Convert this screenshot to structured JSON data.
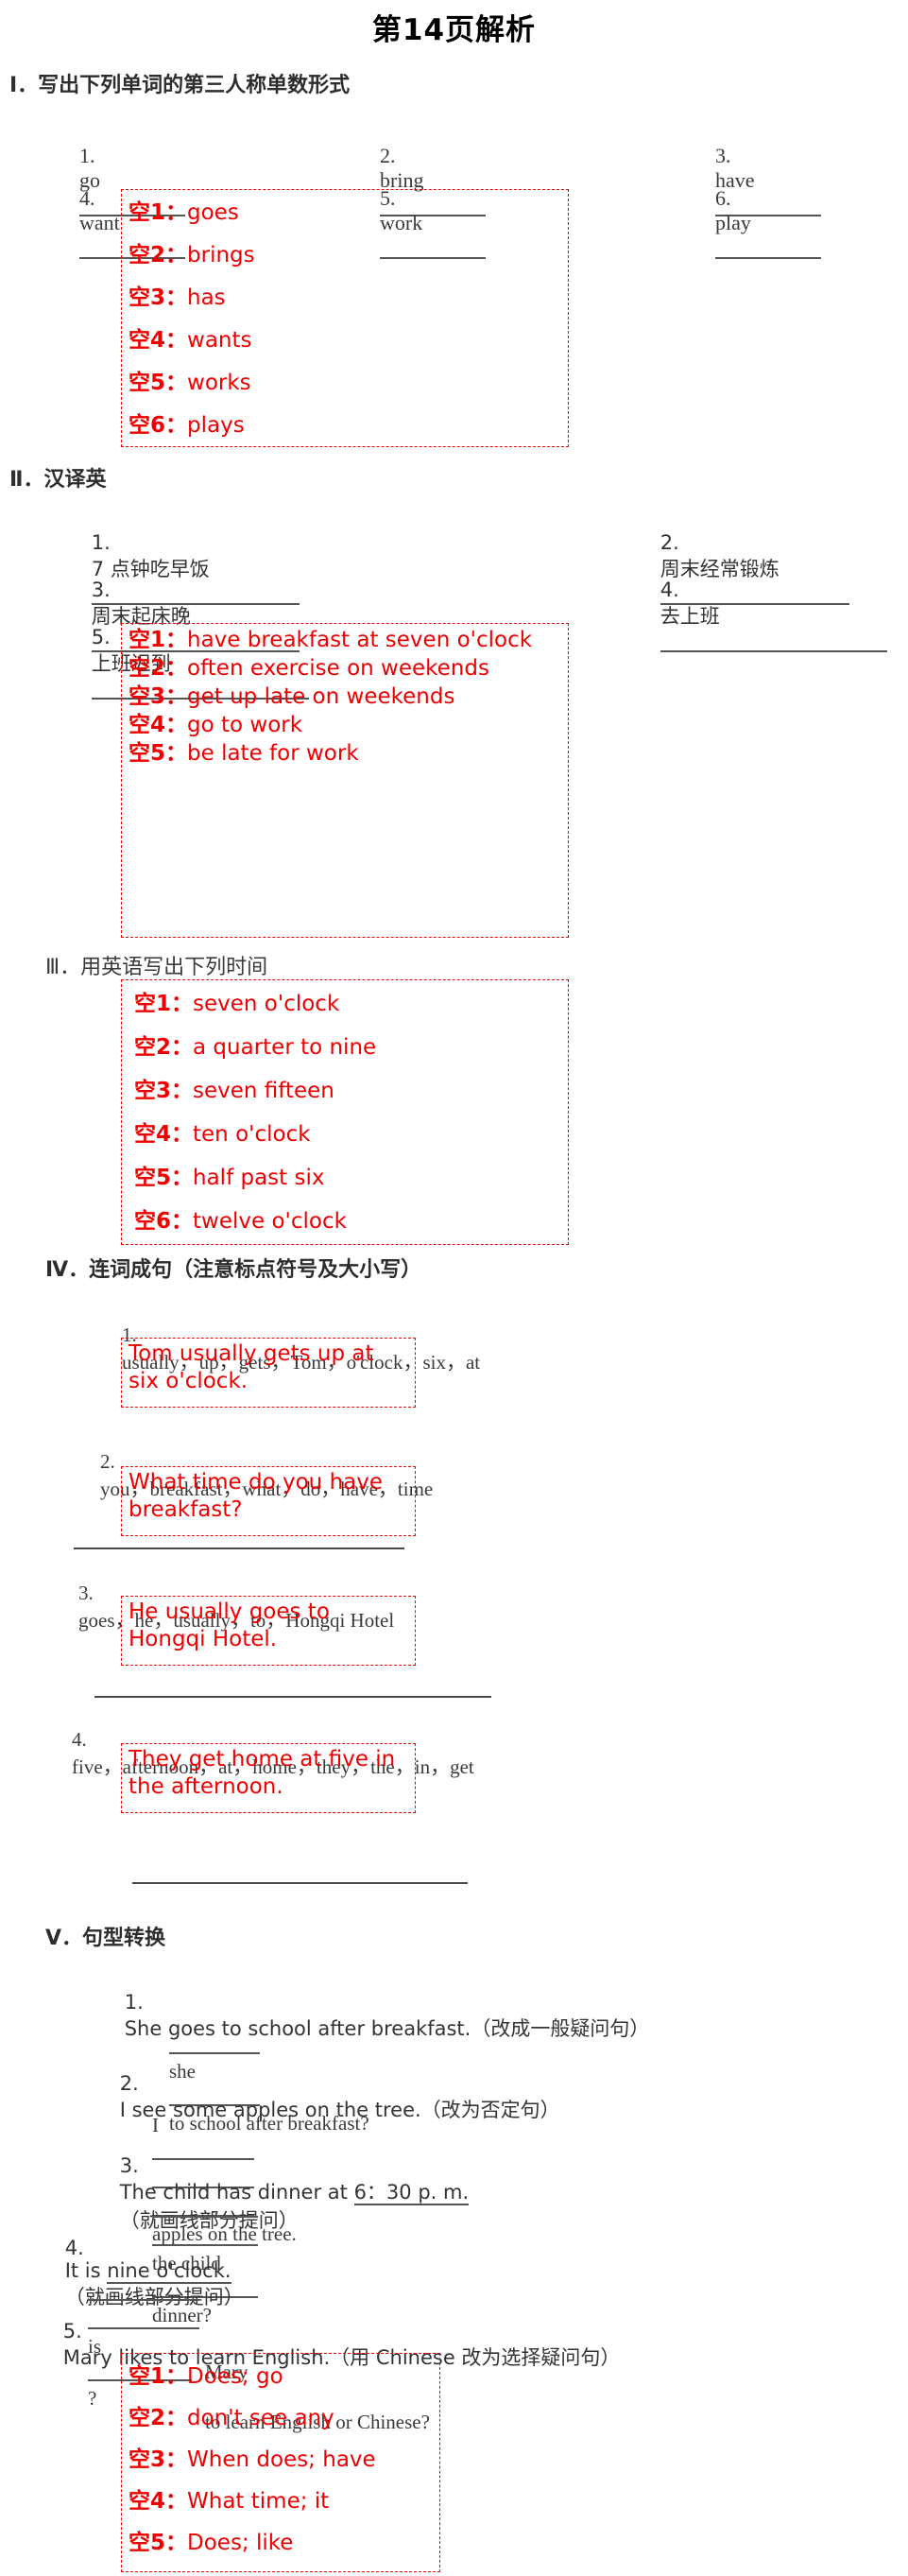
{
  "page": {
    "title": "第14页解析",
    "answer_label_prefix": "空",
    "answer_separator": "："
  },
  "sections": [
    {
      "id": "I",
      "numeral": "Ⅰ",
      "heading": "Ⅰ．写出下列单词的第三人称单数形式",
      "items": [
        {
          "num": "1.",
          "text": "go"
        },
        {
          "num": "2.",
          "text": "bring"
        },
        {
          "num": "3.",
          "text": "have"
        },
        {
          "num": "4.",
          "text": "want"
        },
        {
          "num": "5.",
          "text": "work"
        },
        {
          "num": "6.",
          "text": "play"
        }
      ],
      "answers": [
        {
          "label": "空1：",
          "value": "goes"
        },
        {
          "label": "空2：",
          "value": "brings"
        },
        {
          "label": "空3：",
          "value": "has"
        },
        {
          "label": "空4：",
          "value": "wants"
        },
        {
          "label": "空5：",
          "value": "works"
        },
        {
          "label": "空6：",
          "value": "plays"
        }
      ]
    },
    {
      "id": "II",
      "numeral": "Ⅱ",
      "heading": "Ⅱ．汉译英",
      "items": [
        {
          "num": "1.",
          "text": "7 点钟吃早饭"
        },
        {
          "num": "2.",
          "text": "周末经常锻炼"
        },
        {
          "num": "3.",
          "text": "周末起床晚"
        },
        {
          "num": "4.",
          "text": "去上班"
        },
        {
          "num": "5.",
          "text": "上班迟到"
        }
      ],
      "answers": [
        {
          "label": "空1：",
          "value": "have breakfast at seven o'clock"
        },
        {
          "label": "空2：",
          "value": "often exercise on weekends"
        },
        {
          "label": "空3：",
          "value": "get up late on weekends"
        },
        {
          "label": "空4：",
          "value": "go to work"
        },
        {
          "label": "空5：",
          "value": "be late for work"
        }
      ]
    },
    {
      "id": "III",
      "numeral": "Ⅲ",
      "heading": "Ⅲ．用英语写出下列时间",
      "items": [],
      "answers": [
        {
          "label": "空1：",
          "value": "seven o'clock"
        },
        {
          "label": "空2：",
          "value": "a quarter to nine"
        },
        {
          "label": "空3：",
          "value": "seven fifteen"
        },
        {
          "label": "空4：",
          "value": "ten o'clock"
        },
        {
          "label": "空5：",
          "value": "half past six"
        },
        {
          "label": "空6：",
          "value": "twelve o'clock"
        }
      ]
    },
    {
      "id": "IV",
      "numeral": "Ⅳ",
      "heading": "Ⅳ．连词成句（注意标点符号及大小写）",
      "items": [
        {
          "num": "1.",
          "text": "usually，up，gets，Tom，o'clock，six，at",
          "answer": "Tom usually gets up at six o'clock."
        },
        {
          "num": "2.",
          "text": "you，breakfast，what，do，have，time",
          "answer": "What time do you have breakfast?"
        },
        {
          "num": "3.",
          "text": "goes，he，usually，to，Hongqi Hotel",
          "answer": "He usually goes to Hongqi Hotel."
        },
        {
          "num": "4.",
          "text": "five，afternoon，at，home，they，the，in，get",
          "answer": "They get home at five in the afternoon."
        }
      ]
    },
    {
      "id": "V",
      "numeral": "Ⅴ",
      "heading": "Ⅴ．句型转换",
      "items": [
        {
          "num": "1.",
          "prompt": "She goes to school after breakfast.（改成一般疑问句）",
          "answer_line_pre": "",
          "answer_line_mid": "she",
          "answer_line_post": "to school after breakfast?"
        },
        {
          "num": "2.",
          "prompt": "I see some apples on the tree.（改为否定句）",
          "answer_line_pre": "I",
          "answer_line_post": "apples on the tree."
        },
        {
          "num": "3.",
          "prompt_pre": "The child has dinner at ",
          "prompt_underline": "6：30 p. m.",
          "prompt_post": "（就画线部分提问）",
          "answer_line_mid": "the child",
          "answer_line_post": "dinner?"
        },
        {
          "num": "4.",
          "prompt_pre": "It is ",
          "prompt_underline": "nine o'clock.",
          "prompt_post": "（就画线部分提问）",
          "answer_line_mid": "is",
          "answer_line_post": "?"
        },
        {
          "num": "5.",
          "prompt": "Mary likes to learn English.（用 Chinese 改为选择疑问句）",
          "answer_line_pre": "Mary",
          "answer_line_post": "to learn English or Chinese?"
        }
      ],
      "answers": [
        {
          "label": "空1：",
          "value": "Does; go"
        },
        {
          "label": "空2：",
          "value": "don't see any"
        },
        {
          "label": "空3：",
          "value": "When does; have"
        },
        {
          "label": "空4：",
          "value": "What time; it"
        },
        {
          "label": "空5：",
          "value": "Does; like"
        }
      ]
    }
  ],
  "colors": {
    "answer_red": "#ee0000",
    "scan_ink": "#2b2b2b",
    "paper": "#ffffff"
  }
}
